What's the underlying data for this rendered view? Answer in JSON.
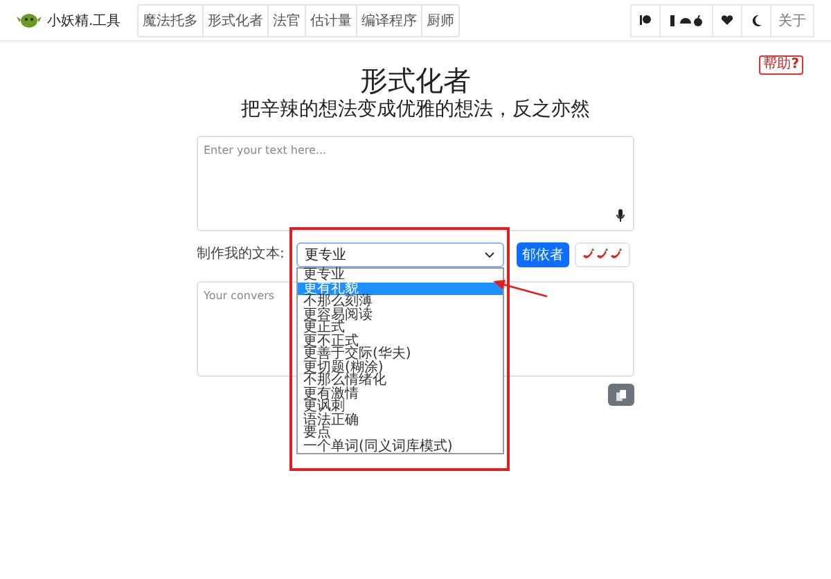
{
  "brand": {
    "name": "小妖精.工具"
  },
  "nav_tabs": [
    {
      "label": "魔法托多"
    },
    {
      "label": "形式化者"
    },
    {
      "label": "法官"
    },
    {
      "label": "估计量"
    },
    {
      "label": "编译程序"
    },
    {
      "label": "厨师"
    }
  ],
  "toolbar": {
    "about": "关于"
  },
  "help_button": "帮助",
  "help_mark": "?",
  "heading": "形式化者",
  "subheading": "把辛辣的想法变成优雅的想法，反之亦然",
  "input": {
    "placeholder": "Enter your text here..."
  },
  "control_row": {
    "label": "制作我的文本:",
    "select_value": "更专业",
    "button": "郁依者"
  },
  "dropdown": [
    {
      "label": "更专业",
      "selected": false
    },
    {
      "label": "更有礼貌",
      "selected": true
    },
    {
      "label": "不那么刻薄",
      "selected": false
    },
    {
      "label": "更容易阅读",
      "selected": false
    },
    {
      "label": "更正式",
      "selected": false
    },
    {
      "label": "更不正式",
      "selected": false
    },
    {
      "label": "更善于交际(华夫)",
      "selected": false
    },
    {
      "label": "更切题(糊涂)",
      "selected": false
    },
    {
      "label": "不那么情绪化",
      "selected": false
    },
    {
      "label": "更有激情",
      "selected": false
    },
    {
      "label": "更讽刺",
      "selected": false
    },
    {
      "label": "语法正确",
      "selected": false
    },
    {
      "label": "要点",
      "selected": false
    },
    {
      "label": "一个单词(同义词库模式)",
      "selected": false
    }
  ],
  "output": {
    "placeholder": "Your convers"
  }
}
